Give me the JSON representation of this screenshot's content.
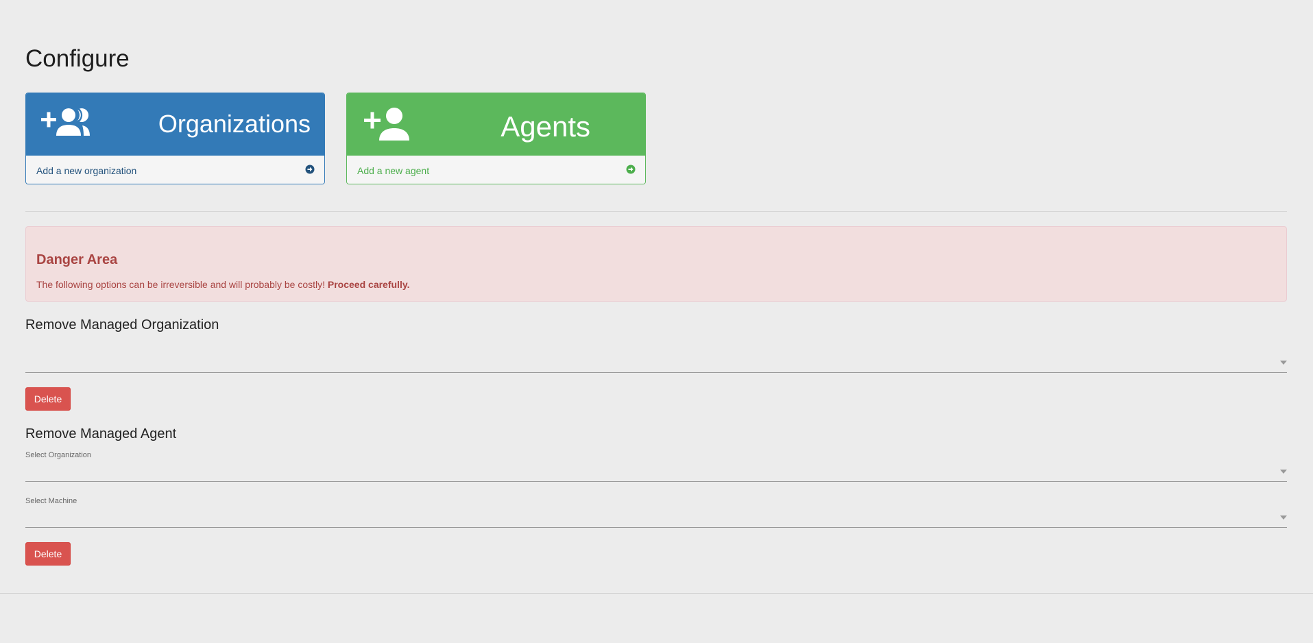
{
  "page": {
    "title": "Configure"
  },
  "panels": {
    "organizations": {
      "count_label": "Organizations",
      "footer_label": "Add a new organization",
      "icon": "group-add-icon",
      "color": "#337ab7"
    },
    "agents": {
      "count_label": "Agents",
      "footer_label": "Add a new agent",
      "icon": "person-add-icon",
      "color": "#5cb85c"
    }
  },
  "danger": {
    "title": "Danger Area",
    "text": "The following options can be irreversible and will probably be costly! ",
    "emphasis": "Proceed carefully.",
    "color": "#a94442"
  },
  "remove_org": {
    "title": "Remove Managed Organization",
    "select_value": "",
    "button_label": "Delete"
  },
  "remove_agent": {
    "title": "Remove Managed Agent",
    "org_label": "Select Organization",
    "org_value": "",
    "machine_label": "Select Machine",
    "machine_value": "",
    "button_label": "Delete"
  }
}
